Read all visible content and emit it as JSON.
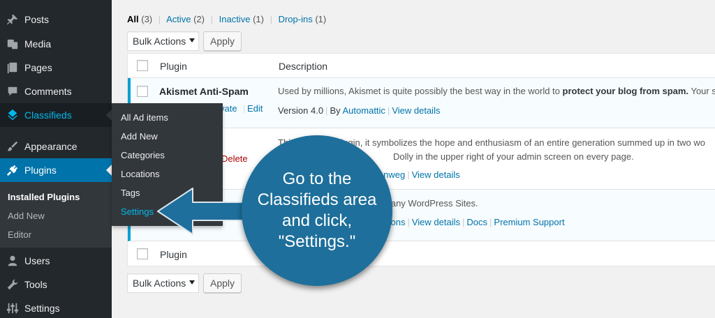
{
  "sidebar": {
    "posts": "Posts",
    "media": "Media",
    "pages": "Pages",
    "comments": "Comments",
    "classifieds": "Classifieds",
    "appearance": "Appearance",
    "plugins": "Plugins",
    "plugins_submenu": [
      "Installed Plugins",
      "Add New",
      "Editor"
    ],
    "users": "Users",
    "tools": "Tools",
    "settings": "Settings"
  },
  "flyout": [
    "All Ad items",
    "Add New",
    "Categories",
    "Locations",
    "Tags",
    "Settings"
  ],
  "filters": {
    "all": "All",
    "all_count": "(3)",
    "active": "Active",
    "active_count": "(2)",
    "inactive": "Inactive",
    "inactive_count": "(1)",
    "dropins": "Drop-ins",
    "dropins_count": "(1)",
    "separator": "|"
  },
  "bulk": {
    "select_label": "Bulk Actions",
    "apply_label": "Apply"
  },
  "table": {
    "col_plugin": "Plugin",
    "col_description": "Description",
    "rows": [
      {
        "name": "Akismet Anti-Spam",
        "actions": [
          "vate",
          "Edit"
        ],
        "description_prefix": "Used by millions, Akismet is quite possibly the best way in the world to ",
        "description_bold": "protect your blog from spam.",
        "description_suffix": " Your si",
        "version": "Version 4.0",
        "by": "By",
        "author": "Automattic",
        "details": "View details"
      },
      {
        "action": "Delete",
        "description_line1_start": "Thi",
        "description_line1_end": "plugin, it symbolizes the hope and enthusiasm of an entire generation summed up in two wo",
        "description_line2": "Dolly in the upper right of your admin screen on every page.",
        "author_fragment": "lenweg",
        "details": "View details"
      },
      {
        "description_fragment": "n any WordPress Sites.",
        "link_fragment": "tions",
        "details": "View details",
        "docs": "Docs",
        "support": "Premium Support"
      }
    ],
    "footer_plugin": "Plugin"
  },
  "callout": {
    "text": "Go to the Classifieds area and click, \"Settings.\""
  },
  "colors": {
    "sidebar_bg": "#23282d",
    "accent": "#0073aa",
    "highlight": "#00b9eb",
    "callout": "#1e6f9b"
  }
}
